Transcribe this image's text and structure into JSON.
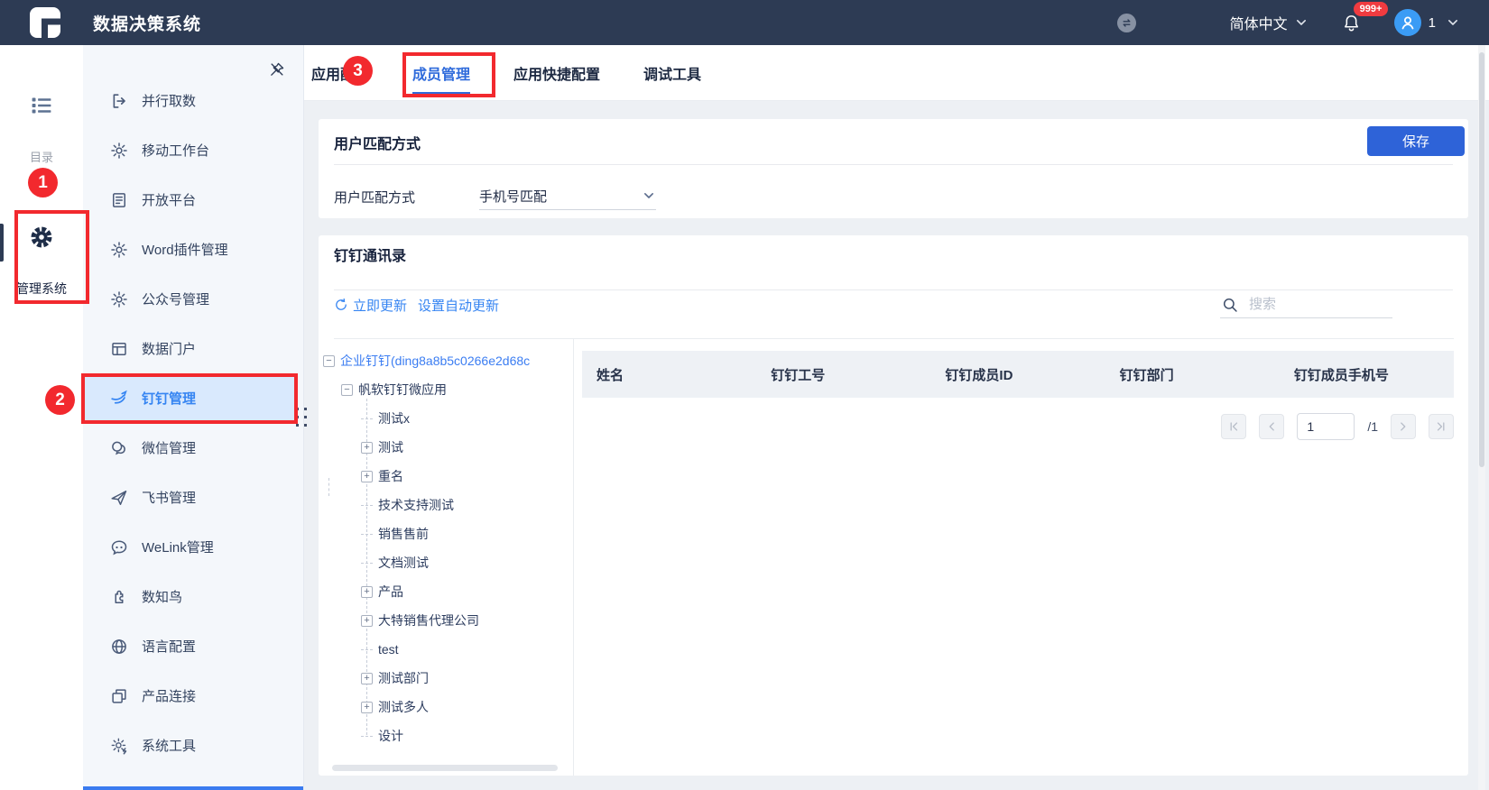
{
  "topbar": {
    "title": "数据决策系统",
    "lang_label": "简体中文",
    "notif_badge": "999+",
    "user_count": "1"
  },
  "rail": {
    "catalog_label": "目录",
    "admin_label": "管理系统"
  },
  "sidebar": {
    "items": [
      {
        "id": "parallel-fetch",
        "label": "并行取数",
        "icon": "export-icon"
      },
      {
        "id": "mobile-workbench",
        "label": "移动工作台",
        "icon": "gear-icon"
      },
      {
        "id": "open-platform",
        "label": "开放平台",
        "icon": "document-icon"
      },
      {
        "id": "word-plugin",
        "label": "Word插件管理",
        "icon": "gear-icon"
      },
      {
        "id": "official-account",
        "label": "公众号管理",
        "icon": "gear-icon"
      },
      {
        "id": "data-portal",
        "label": "数据门户",
        "icon": "portal-icon"
      },
      {
        "id": "dingtalk",
        "label": "钉钉管理",
        "icon": "dingtalk-icon",
        "active": true
      },
      {
        "id": "wechat",
        "label": "微信管理",
        "icon": "wechat-icon"
      },
      {
        "id": "feishu",
        "label": "飞书管理",
        "icon": "feishu-icon"
      },
      {
        "id": "welink",
        "label": "WeLink管理",
        "icon": "welink-icon"
      },
      {
        "id": "shuzhiniao",
        "label": "数知鸟",
        "icon": "puzzle-icon"
      },
      {
        "id": "language-config",
        "label": "语言配置",
        "icon": "globe-icon"
      },
      {
        "id": "product-connect",
        "label": "产品连接",
        "icon": "connect-icon"
      },
      {
        "id": "system-tools",
        "label": "系统工具",
        "icon": "tools-icon"
      }
    ]
  },
  "tabs": [
    {
      "id": "app-config",
      "label": "应用配置"
    },
    {
      "id": "member-management",
      "label": "成员管理",
      "active": true
    },
    {
      "id": "app-shortcut-config",
      "label": "应用快捷配置"
    },
    {
      "id": "debug-tools",
      "label": "调试工具"
    }
  ],
  "match_card": {
    "title": "用户匹配方式",
    "save_label": "保存",
    "field_label": "用户匹配方式",
    "select_value": "手机号匹配"
  },
  "addressbook": {
    "title": "钉钉通讯录",
    "update_now_label": "立即更新",
    "auto_update_label": "设置自动更新",
    "search_placeholder": "搜索",
    "tree": {
      "rows": [
        {
          "id": "enterprise-root",
          "label": "企业钉钉(ding8a8b5c0266e2d68c",
          "level": 0,
          "toggle": "minus",
          "selected": true
        },
        {
          "id": "fanruan-micro-app",
          "label": "帆软钉钉微应用",
          "level": 1,
          "toggle": "minus"
        },
        {
          "id": "test-x",
          "label": "测试x",
          "level": 2,
          "toggle": "none"
        },
        {
          "id": "test",
          "label": "测试",
          "level": 2,
          "toggle": "plus"
        },
        {
          "id": "duplicate-name",
          "label": "重名",
          "level": 2,
          "toggle": "plus"
        },
        {
          "id": "tech-support-test",
          "label": "技术支持测试",
          "level": 2,
          "toggle": "none"
        },
        {
          "id": "sales-presales",
          "label": "销售售前",
          "level": 2,
          "toggle": "none"
        },
        {
          "id": "doc-test",
          "label": "文档测试",
          "level": 2,
          "toggle": "none"
        },
        {
          "id": "product",
          "label": "产品",
          "level": 2,
          "toggle": "plus"
        },
        {
          "id": "date-sales-agency",
          "label": "大特销售代理公司",
          "level": 2,
          "toggle": "plus"
        },
        {
          "id": "test-en",
          "label": "test",
          "level": 2,
          "toggle": "none"
        },
        {
          "id": "test-dept",
          "label": "测试部门",
          "level": 2,
          "toggle": "plus"
        },
        {
          "id": "test-multi",
          "label": "测试多人",
          "level": 2,
          "toggle": "plus"
        },
        {
          "id": "design",
          "label": "设计",
          "level": 2,
          "toggle": "none"
        }
      ]
    },
    "table": {
      "headers": [
        "姓名",
        "钉钉工号",
        "钉钉成员ID",
        "钉钉部门",
        "钉钉成员手机号"
      ]
    },
    "pagination": {
      "page": "1",
      "total_label": "/1"
    }
  },
  "annotations": {
    "steps": [
      "1",
      "2",
      "3"
    ]
  },
  "colors": {
    "topbar_bg": "#2d3b54",
    "accent_blue": "#3685f2",
    "active_tab_blue": "#2f6bdb",
    "save_button_blue": "#2e63d8",
    "annotation_red": "#f2292e",
    "active_item_bg": "#d9e9fd",
    "avatar_blue": "#3b9cf5",
    "badge_red": "#f03b40"
  }
}
